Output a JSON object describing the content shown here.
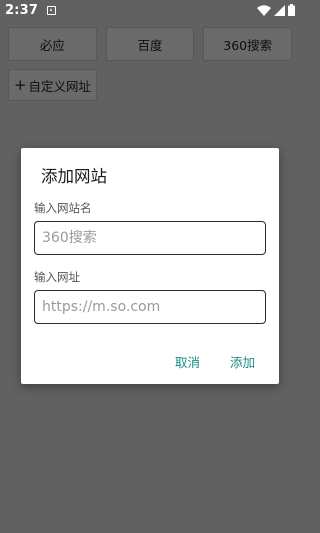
{
  "status_bar": {
    "time": "2:37",
    "notification_icon": "notification-app-icon",
    "wifi_icon": "wifi-icon",
    "signal_icon": "cell-signal-icon",
    "battery_icon": "battery-icon"
  },
  "engines": [
    {
      "label": "必应"
    },
    {
      "label": "百度"
    },
    {
      "label": "360搜索"
    }
  ],
  "custom_button": {
    "icon": "plus-icon",
    "label": "自定义网址"
  },
  "dialog": {
    "title": "添加网站",
    "name_label": "输入网站名",
    "name_placeholder": "360搜索",
    "url_label": "输入网址",
    "url_placeholder": "https://m.so.com",
    "cancel_label": "取消",
    "add_label": "添加"
  },
  "colors": {
    "background_scrim": "#616161",
    "accent": "#1a8a82",
    "dialog_bg": "#ffffff"
  }
}
